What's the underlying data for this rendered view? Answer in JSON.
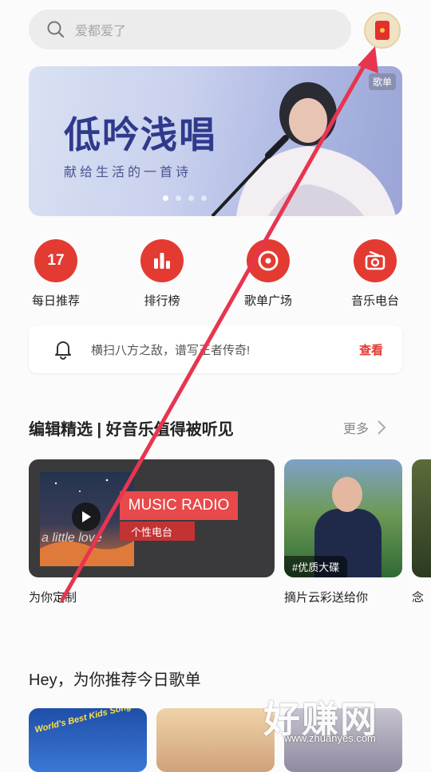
{
  "search": {
    "placeholder": "爱都爱了"
  },
  "banner": {
    "title": "低吟浅唱",
    "subtitle": "献给生活的一首诗",
    "tag": "歌单",
    "pages": 4,
    "active_page": 1
  },
  "quick_nav": [
    {
      "label": "每日推荐",
      "icon": "calendar-17-icon",
      "value": "17"
    },
    {
      "label": "排行榜",
      "icon": "chart-bars-icon"
    },
    {
      "label": "歌单广场",
      "icon": "disc-icon"
    },
    {
      "label": "音乐电台",
      "icon": "radio-icon"
    }
  ],
  "notice": {
    "text": "横扫八方之敌，谱写王者传奇!",
    "action": "查看"
  },
  "editor_section": {
    "title": "编辑精选 | 好音乐值得被听见",
    "more": "更多",
    "cards": [
      {
        "caption": "为你定制",
        "tag": "MUSIC RADIO",
        "sub_tag": "个性电台",
        "overlay_text": "a little love"
      },
      {
        "caption": "摘片云彩送给你",
        "badge": "#优质大碟"
      },
      {
        "caption": "念"
      }
    ]
  },
  "playlist_section": {
    "title": "Hey，为你推荐今日歌单"
  },
  "playlist_thumb_texts": [
    "World's Best Kids Songs"
  ],
  "watermark": {
    "text": "好赚网",
    "url": "www.zhuanyes.com"
  },
  "colors": {
    "accent": "#e33b32",
    "annotation_arrow": "#e8354f"
  }
}
